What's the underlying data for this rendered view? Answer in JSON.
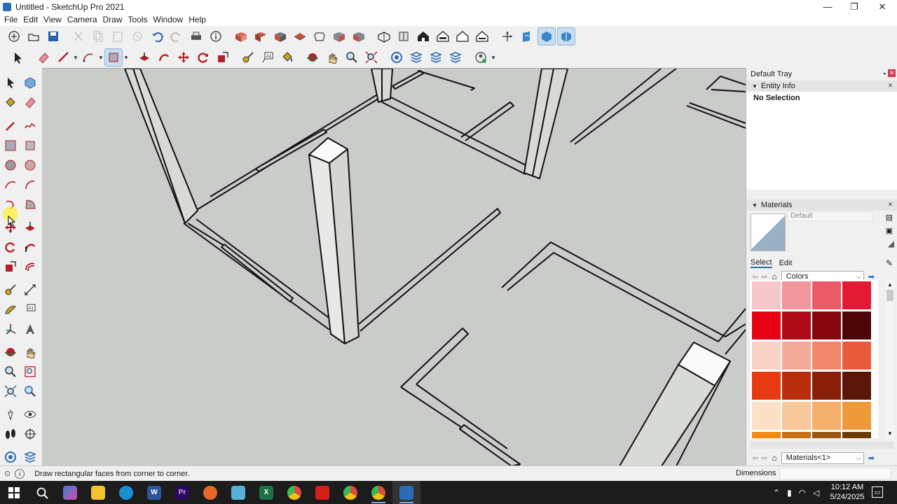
{
  "window": {
    "title": "Untitled - SketchUp Pro 2021",
    "minimize": "—",
    "maximize": "❐",
    "close": "✕"
  },
  "menu": [
    "File",
    "Edit",
    "View",
    "Camera",
    "Draw",
    "Tools",
    "Window",
    "Help"
  ],
  "active_tool": "rectangle",
  "tray": {
    "title": "Default Tray",
    "entity_info": {
      "title": "Entity Info",
      "selection": "No Selection"
    },
    "materials": {
      "title": "Materials",
      "name": "Default",
      "tabs": [
        "Select",
        "Edit"
      ],
      "library": "Colors",
      "bottom_library": "Materials<1>",
      "swatches": [
        "#f7c7cb",
        "#f2959c",
        "#ec5a68",
        "#e21b35",
        "#e60012",
        "#b00a18",
        "#86050f",
        "#4e0508",
        "#f8d2c8",
        "#f4aa98",
        "#f0876a",
        "#e85a3a",
        "#e83a10",
        "#b82d0e",
        "#8a200a",
        "#5a1608",
        "#fce1c8",
        "#f8c79a",
        "#f4af6a",
        "#ee9a3c",
        "#f08a10",
        "#c87010",
        "#985410",
        "#6a3a08"
      ]
    }
  },
  "status": {
    "message": "Draw rectangular faces from corner to corner.",
    "vcb_label": "Dimensions",
    "vcb_value": ""
  },
  "taskbar": {
    "time": "10:12 AM",
    "date": "5/24/2025",
    "apps": [
      {
        "name": "start",
        "color": "#1c1c1c",
        "glyph": ""
      },
      {
        "name": "search",
        "color": "#1c1c1c",
        "glyph": ""
      },
      {
        "name": "copilot",
        "color": "#3a7fd8",
        "glyph": ""
      },
      {
        "name": "file-explorer",
        "color": "#f2c12e",
        "glyph": ""
      },
      {
        "name": "edge",
        "color": "#1a8fd6",
        "glyph": "e"
      },
      {
        "name": "word",
        "color": "#2b579a",
        "glyph": "W"
      },
      {
        "name": "premiere",
        "color": "#2a0a5e",
        "glyph": "Pr"
      },
      {
        "name": "firefox",
        "color": "#e8682a",
        "glyph": ""
      },
      {
        "name": "notepad",
        "color": "#5ab0d8",
        "glyph": ""
      },
      {
        "name": "excel",
        "color": "#1e7145",
        "glyph": "X"
      },
      {
        "name": "chrome",
        "color": "#dd4b39",
        "glyph": ""
      },
      {
        "name": "acrobat",
        "color": "#d4201a",
        "glyph": ""
      },
      {
        "name": "chrome-2",
        "color": "#dd4b39",
        "glyph": ""
      },
      {
        "name": "chrome-3",
        "color": "#dd4b39",
        "glyph": ""
      },
      {
        "name": "sketchup",
        "color": "#2a6db5",
        "glyph": ""
      }
    ]
  }
}
